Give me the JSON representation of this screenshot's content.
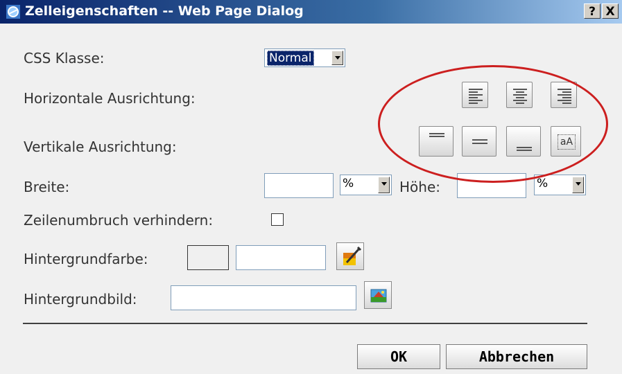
{
  "window": {
    "title": "Zelleigenschaften -- Web Page Dialog",
    "help_label": "?",
    "close_label": "X"
  },
  "form": {
    "css_class_label": "CSS Klasse:",
    "css_class_value": "Normal",
    "h_align_label": "Horizontale Ausrichtung:",
    "v_align_label": "Vertikale Ausrichtung:",
    "width_label": "Breite:",
    "width_value": "",
    "width_unit": "%",
    "height_label": "Höhe:",
    "height_value": "",
    "height_unit": "%",
    "nowrap_label": "Zeilenumbruch verhindern:",
    "nowrap_checked": false,
    "bgcolor_label": "Hintergrundfarbe:",
    "bgcolor_value": "",
    "bgimage_label": "Hintergrundbild:",
    "bgimage_value": "",
    "valign_baseline_glyph": "aA"
  },
  "buttons": {
    "ok_label": "OK",
    "cancel_label": "Abbrechen"
  },
  "icons": {
    "h_align": [
      "align-left-icon",
      "align-center-icon",
      "align-right-icon"
    ],
    "v_align": [
      "valign-top-icon",
      "valign-middle-icon",
      "valign-bottom-icon",
      "valign-baseline-icon"
    ],
    "color_picker": "color-picker-icon",
    "image_picker": "image-picker-icon"
  },
  "colors": {
    "title_bar": "#0a246a",
    "highlight_ellipse": "#cc1f1f",
    "selected_option": "#0a246a"
  }
}
